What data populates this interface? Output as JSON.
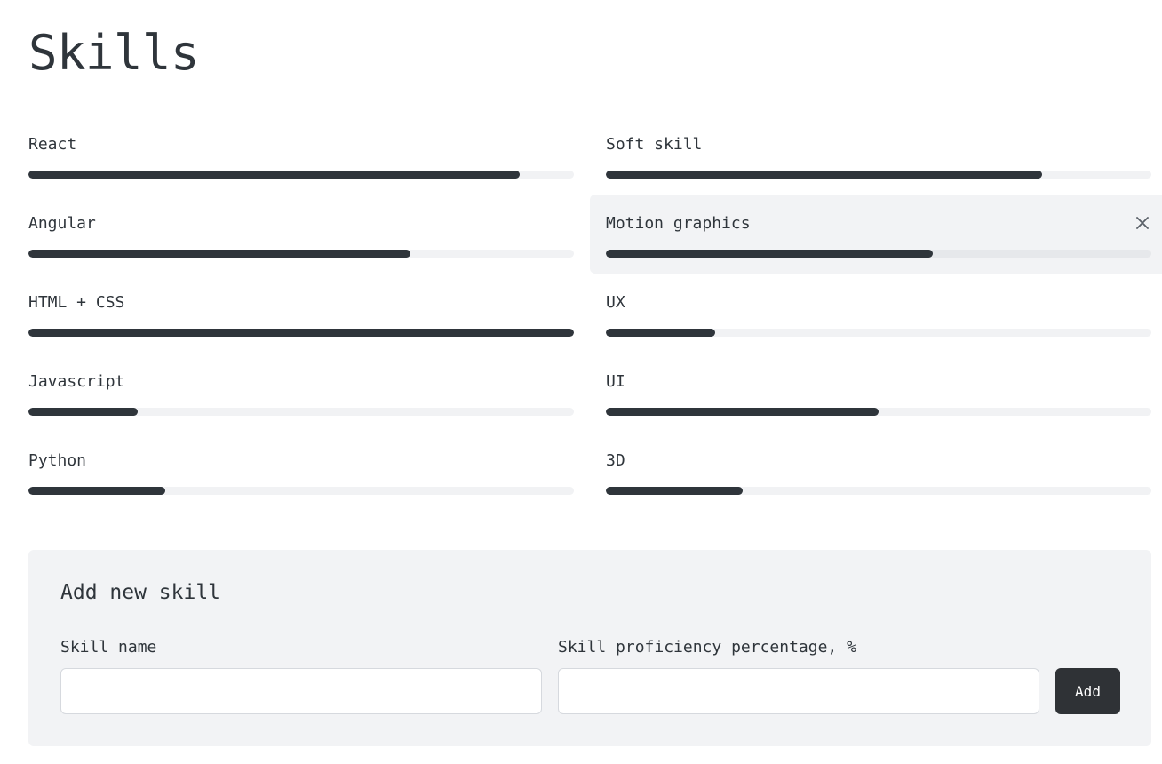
{
  "page": {
    "title": "Skills"
  },
  "skills": [
    {
      "label": "React",
      "percent": 90
    },
    {
      "label": "Soft skill",
      "percent": 80
    },
    {
      "label": "Angular",
      "percent": 70
    },
    {
      "label": "Motion graphics",
      "percent": 60,
      "hovered": true
    },
    {
      "label": "HTML + CSS",
      "percent": 100
    },
    {
      "label": "UX",
      "percent": 20
    },
    {
      "label": "Javascript",
      "percent": 20
    },
    {
      "label": "UI",
      "percent": 50
    },
    {
      "label": "Python",
      "percent": 25
    },
    {
      "label": "3D",
      "percent": 25
    }
  ],
  "add_form": {
    "title": "Add new skill",
    "name_label": "Skill name",
    "name_value": "",
    "percent_label": "Skill proficiency percentage, %",
    "percent_value": "",
    "button_label": "Add"
  },
  "icons": {
    "remove": "close-icon"
  },
  "colors": {
    "text": "#2f353b",
    "bar_fill": "#2f353b",
    "bar_track": "#f1f2f4",
    "panel_bg": "#f2f3f5",
    "button_bg": "#2f3236"
  }
}
